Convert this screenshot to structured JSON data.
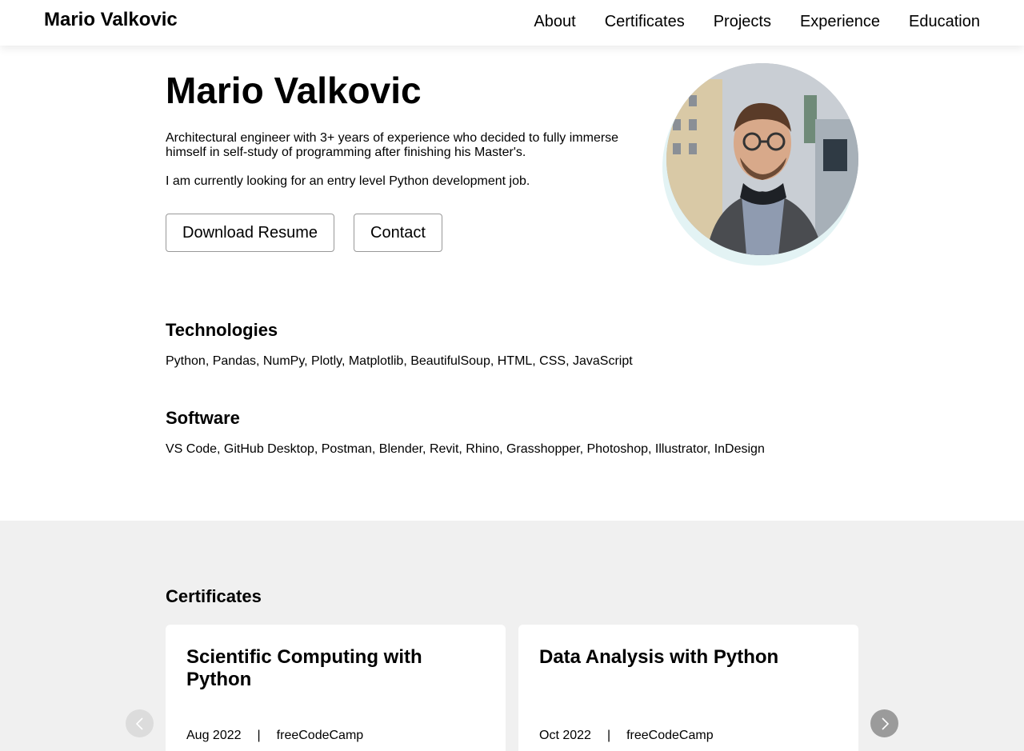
{
  "navbar": {
    "brand": "Mario Valkovic",
    "links": [
      "About",
      "Certificates",
      "Projects",
      "Experience",
      "Education"
    ]
  },
  "hero": {
    "title": "Mario Valkovic",
    "intro": "Architectural engineer with 3+ years of experience who decided to fully immerse himself in self-study of programming after finishing his Master's.",
    "goal": "I am currently looking for an entry level Python development job.",
    "resume_button": "Download Resume",
    "contact_button": "Contact"
  },
  "skills": {
    "technologies_heading": "Technologies",
    "technologies": "Python, Pandas, NumPy, Plotly, Matplotlib, BeautifulSoup, HTML, CSS, JavaScript",
    "software_heading": "Software",
    "software": "VS Code, GitHub Desktop, Postman, Blender, Revit, Rhino, Grasshopper, Photoshop, Illustrator, InDesign"
  },
  "certificates": {
    "heading": "Certificates",
    "cards": [
      {
        "title": "Scientific Computing with Python",
        "date": "Aug 2022",
        "separator": "|",
        "issuer": "freeCodeCamp"
      },
      {
        "title": "Data Analysis with Python",
        "date": "Oct 2022",
        "separator": "|",
        "issuer": "freeCodeCamp"
      }
    ],
    "prev_icon": "chevron-left-icon",
    "next_icon": "chevron-right-icon"
  },
  "colors": {
    "accent_ring": "#e3f3f4",
    "section_bg": "#f0f0f0"
  }
}
